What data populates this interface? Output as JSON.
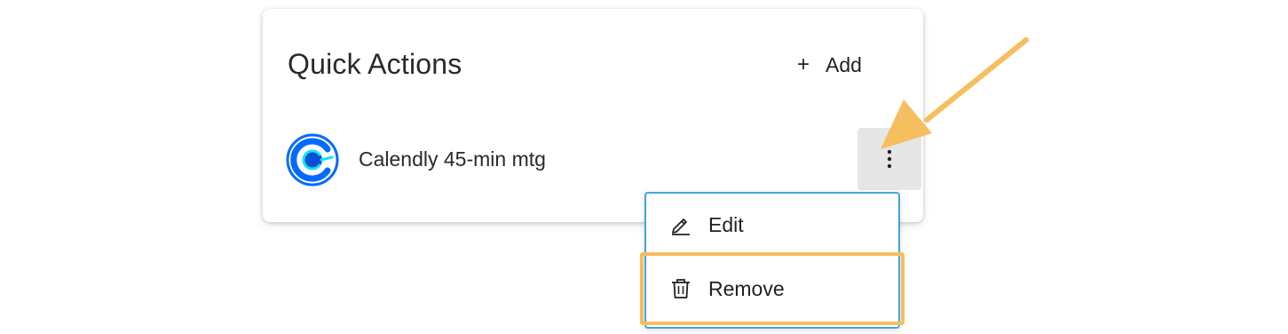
{
  "card": {
    "title": "Quick Actions",
    "add_label": "Add",
    "add_icon": "plus-icon"
  },
  "items": [
    {
      "label": "Calendly 45-min mtg",
      "icon": "calendly-logo-icon",
      "menu_icon": "kebab-menu-icon"
    }
  ],
  "menu": {
    "edit_label": "Edit",
    "edit_icon": "pencil-icon",
    "remove_label": "Remove",
    "remove_icon": "trash-icon"
  },
  "colors": {
    "menu_border": "#42a6d8",
    "highlight": "#f7be5e",
    "arrow": "#f5be5f",
    "calendly_blue": "#006bff",
    "calendly_cyan": "#0ae8f0"
  }
}
